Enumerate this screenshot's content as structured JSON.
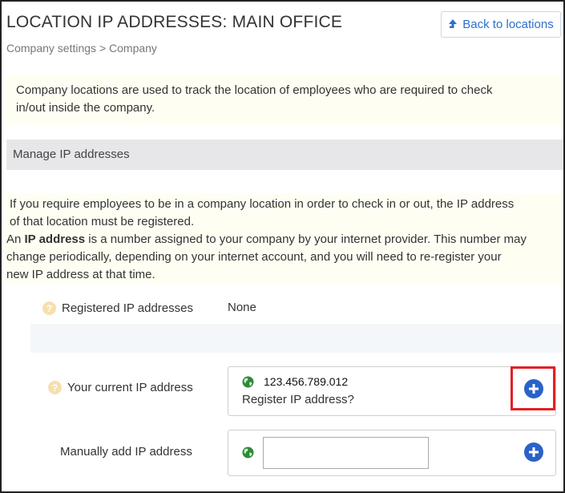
{
  "header": {
    "title": "LOCATION IP ADDRESSES: MAIN OFFICE",
    "breadcrumb": "Company settings > Company",
    "back_button_label": "Back to locations",
    "back_icon": "arrow-up-icon"
  },
  "info_note": {
    "line1": "Company locations are used to track the location of employees who are required to check",
    "line2": "in/out inside the company."
  },
  "section": {
    "title": "Manage IP addresses"
  },
  "ip_info": {
    "line1": "If you require employees to be in a company location in order to check in or out, the IP address",
    "line2": "of that location must be registered.",
    "line3_pre": "An ",
    "line3_bold": "IP address",
    "line3_post": " is a number assigned to your company by your internet provider. This number may",
    "line4": "change periodically,  depending on your internet account, and you will need to re-register  your",
    "line5": "new IP address at that time."
  },
  "registered": {
    "label": "Registered IP addresses",
    "value": "None",
    "help_icon": "?"
  },
  "current": {
    "label": "Your current IP address",
    "ip": "123.456.789.012",
    "register_text": "Register IP address?",
    "help_icon": "?"
  },
  "manual": {
    "label": "Manually add IP address",
    "input_value": "",
    "input_placeholder": ""
  },
  "colors": {
    "accent": "#2a62c9",
    "highlight": "#e21f26",
    "note_bg": "#fefef3",
    "globe": "#2e8b3a"
  }
}
